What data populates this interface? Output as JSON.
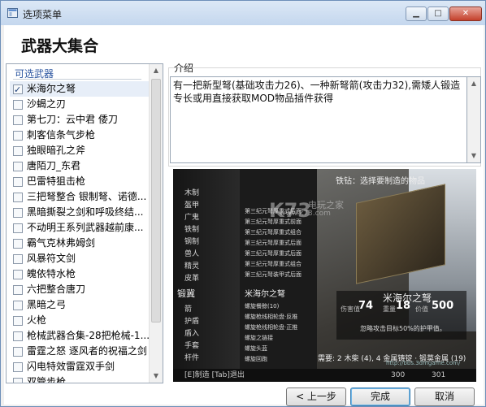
{
  "window": {
    "title": "选项菜单"
  },
  "page": {
    "heading": "武器大集合"
  },
  "weapons": {
    "header": "可选武器",
    "items": [
      {
        "label": "米海尔之弩",
        "checked": true,
        "selected": true
      },
      {
        "label": "沙蝎之刃",
        "checked": false,
        "selected": false
      },
      {
        "label": "第七刀：云中君 倭刀",
        "checked": false,
        "selected": false
      },
      {
        "label": "刺客信条气步枪",
        "checked": false,
        "selected": false
      },
      {
        "label": "独眼暗孔之斧",
        "checked": false,
        "selected": false
      },
      {
        "label": "唐陌刀_东君",
        "checked": false,
        "selected": false
      },
      {
        "label": "巴雷特狙击枪",
        "checked": false,
        "selected": false
      },
      {
        "label": "三把弩整合 银制弩、诺德...",
        "checked": false,
        "selected": false
      },
      {
        "label": "黑暗撕裂之剑和呼吸终结...",
        "checked": false,
        "selected": false
      },
      {
        "label": "不动明王系列武器越前康...",
        "checked": false,
        "selected": false
      },
      {
        "label": "霸气克林弗姆剑",
        "checked": false,
        "selected": false
      },
      {
        "label": "风暴符文剑",
        "checked": false,
        "selected": false
      },
      {
        "label": "魄依特水枪",
        "checked": false,
        "selected": false
      },
      {
        "label": "六把整合唐刀",
        "checked": false,
        "selected": false
      },
      {
        "label": "黑暗之弓",
        "checked": false,
        "selected": false
      },
      {
        "label": "火枪",
        "checked": false,
        "selected": false
      },
      {
        "label": "枪械武器合集-28把枪械-1...",
        "checked": false,
        "selected": false
      },
      {
        "label": "雷霆之怒 逐风者的祝福之剑",
        "checked": false,
        "selected": false
      },
      {
        "label": "闪电特效雷霆双手剑",
        "checked": false,
        "selected": false
      },
      {
        "label": "双管步枪",
        "checked": false,
        "selected": false
      },
      {
        "label": "泰瑞尔之剑特突",
        "checked": false,
        "selected": false
      }
    ]
  },
  "description": {
    "label": "介绍",
    "text": "有一把新型弩(基础攻击力26)、一种新弩箭(攻击力32),需矮人锻造专长或用直接获取MOD物品插件获得"
  },
  "preview": {
    "logo": "K73",
    "logo_sub": "电玩之家",
    "logo_url": "www.k73.com",
    "header": "铁钻：选择要制造的物品",
    "left_menu": [
      "木制",
      "盔甲",
      "广鬼",
      "铁制",
      "钢制",
      "兽人",
      "精灵",
      "皮革"
    ],
    "left_highlight": "锻冀",
    "left_menu_lower": [
      "箭",
      "护盾",
      "盾入",
      "手套",
      "杆件",
      "文书",
      "龙族",
      "杂项"
    ],
    "mid_items": [
      "第三纪元弩厚重式后面",
      "第三纪元弩厚重式前面",
      "第三纪元弩厚重式组合",
      "第三纪元弩厚重式后面",
      "第三纪元弩厚重式后面",
      "第三纪元弩厚重式组合",
      "第三纪元弩装甲式后面"
    ],
    "mid_highlight": "米海尔之弩",
    "mid_items_lower": [
      "螺旋餐鲸(10)",
      "螺旋枪线相轮盘·反推",
      "螺旋枪线相轮盘·正推",
      "螺旋之链接",
      "螺旋头蓝",
      "螺旋回跑"
    ],
    "item_name": "米海尔之弩",
    "stat_labels": [
      "伤害值",
      "重量",
      "价值"
    ],
    "stat_values": [
      "74",
      "18",
      "500"
    ],
    "item_desc": "忽略攻击目标50%的护甲值。",
    "requirement": "需要: 2 木柴 (4), 4 金属铸锭 · 锻莫金属 (19)",
    "footer_left": "[E]制造   [Tab]退出",
    "footer_level": "300",
    "footer_level2": "301",
    "footer_url": "http://bbs.3dmgame.com/"
  },
  "buttons": {
    "prev": "< 上一步",
    "finish": "完成",
    "cancel": "取消"
  }
}
